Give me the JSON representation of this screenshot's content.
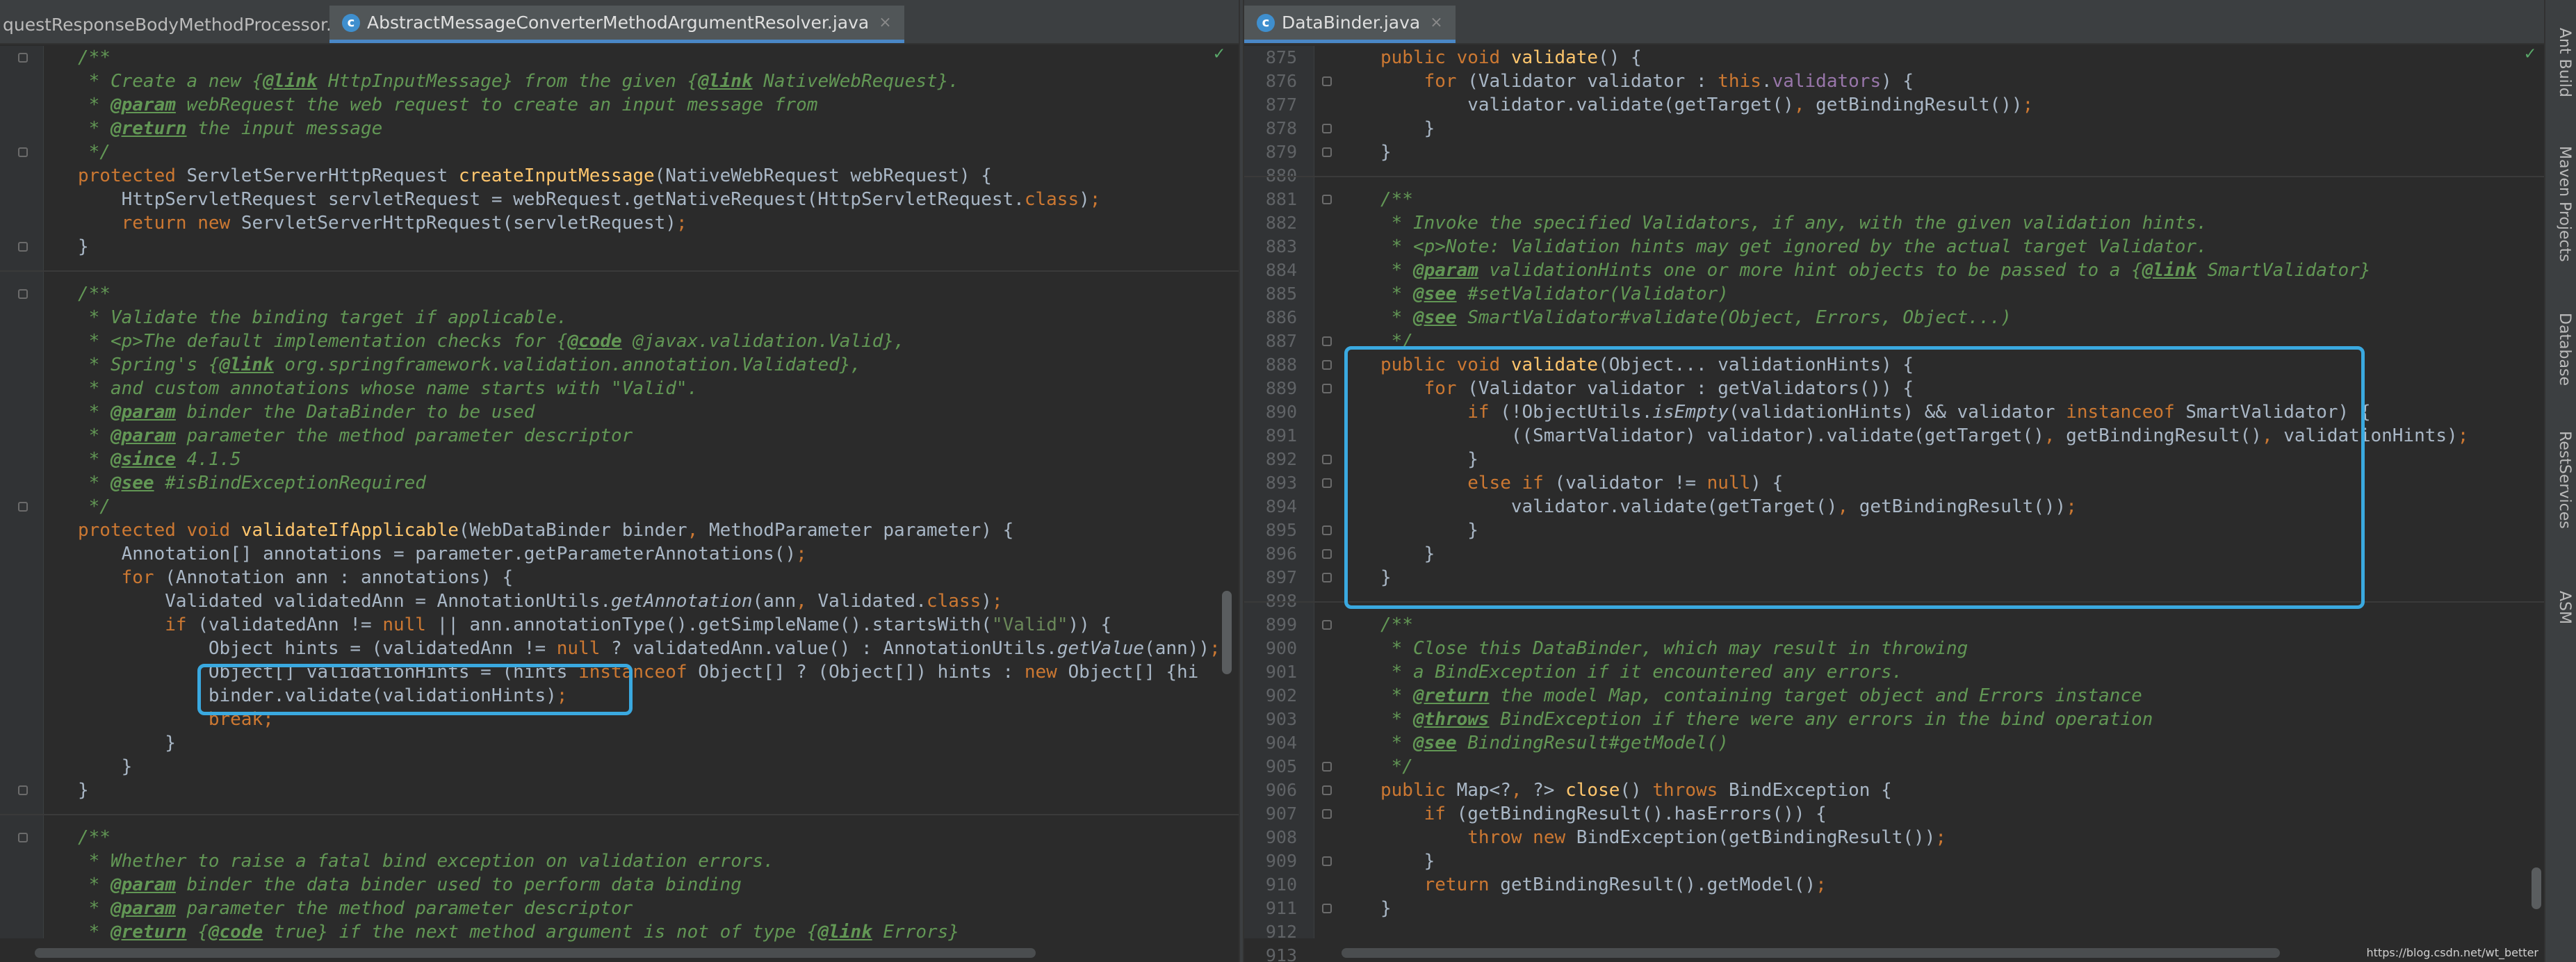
{
  "left_tabs": [
    {
      "label": "questResponseBodyMethodProcessor.java",
      "active": false
    },
    {
      "label": "AbstractMessageConverterMethodArgumentResolver.java",
      "active": true
    }
  ],
  "right_tabs": [
    {
      "label": "DataBinder.java",
      "active": true
    }
  ],
  "icons": {
    "tab_class": "c-icon",
    "close": "close-icon",
    "fold": "fold-icon",
    "check": "check-icon"
  },
  "colors": {
    "keyword": "#cc7832",
    "comment": "#629755",
    "method": "#ffc66d",
    "string": "#6a8759",
    "highlight_box": "#3aa9e0",
    "background": "#2b2b2b"
  },
  "left_code": [
    "/**",
    " * Create a new {@link HttpInputMessage} from the given {@link NativeWebRequest}.",
    " * @param webRequest the web request to create an input message from",
    " * @return the input message",
    " */",
    "protected ServletServerHttpRequest createInputMessage(NativeWebRequest webRequest) {",
    "    HttpServletRequest servletRequest = webRequest.getNativeRequest(HttpServletRequest.class);",
    "    return new ServletServerHttpRequest(servletRequest);",
    "}",
    "",
    "/**",
    " * Validate the binding target if applicable.",
    " * <p>The default implementation checks for {@code @javax.validation.Valid},",
    " * Spring's {@link org.springframework.validation.annotation.Validated},",
    " * and custom annotations whose name starts with \"Valid\".",
    " * @param binder the DataBinder to be used",
    " * @param parameter the method parameter descriptor",
    " * @since 4.1.5",
    " * @see #isBindExceptionRequired",
    " */",
    "protected void validateIfApplicable(WebDataBinder binder, MethodParameter parameter) {",
    "    Annotation[] annotations = parameter.getParameterAnnotations();",
    "    for (Annotation ann : annotations) {",
    "        Validated validatedAnn = AnnotationUtils.getAnnotation(ann, Validated.class);",
    "        if (validatedAnn != null || ann.annotationType().getSimpleName().startsWith(\"Valid\")) {",
    "            Object hints = (validatedAnn != null ? validatedAnn.value() : AnnotationUtils.getValue(ann));",
    "            Object[] validationHints = (hints instanceof Object[] ? (Object[]) hints : new Object[] {hi",
    "            binder.validate(validationHints);",
    "            break;",
    "        }",
    "    }",
    "}",
    "",
    "/**",
    " * Whether to raise a fatal bind exception on validation errors.",
    " * @param binder the data binder used to perform data binding",
    " * @param parameter the method parameter descriptor",
    " * @return {@code true} if the next method argument is not of type {@link Errors}"
  ],
  "right_line_numbers": [
    "875",
    "876",
    "877",
    "878",
    "879",
    "880",
    "881",
    "882",
    "883",
    "884",
    "885",
    "886",
    "887",
    "888",
    "889",
    "890",
    "891",
    "892",
    "893",
    "894",
    "895",
    "896",
    "897",
    "898",
    "899",
    "900",
    "901",
    "902",
    "903",
    "904",
    "905",
    "906",
    "907",
    "908",
    "909",
    "910",
    "911",
    "912",
    "913"
  ],
  "right_code": [
    "public void validate() {",
    "    for (Validator validator : this.validators) {",
    "        validator.validate(getTarget(), getBindingResult());",
    "    }",
    "}",
    "",
    "/**",
    " * Invoke the specified Validators, if any, with the given validation hints.",
    " * <p>Note: Validation hints may get ignored by the actual target Validator.",
    " * @param validationHints one or more hint objects to be passed to a {@link SmartValidator}",
    " * @see #setValidator(Validator)",
    " * @see SmartValidator#validate(Object, Errors, Object...)",
    " */",
    "public void validate(Object... validationHints) {",
    "    for (Validator validator : getValidators()) {",
    "        if (!ObjectUtils.isEmpty(validationHints) && validator instanceof SmartValidator) {",
    "            ((SmartValidator) validator).validate(getTarget(), getBindingResult(), validationHints);",
    "        }",
    "        else if (validator != null) {",
    "            validator.validate(getTarget(), getBindingResult());",
    "        }",
    "    }",
    "}",
    "",
    "/**",
    " * Close this DataBinder, which may result in throwing",
    " * a BindException if it encountered any errors.",
    " * @return the model Map, containing target object and Errors instance",
    " * @throws BindException if there were any errors in the bind operation",
    " * @see BindingResult#getModel()",
    " */",
    "public Map<?, ?> close() throws BindException {",
    "    if (getBindingResult().hasErrors()) {",
    "        throw new BindException(getBindingResult());",
    "    }",
    "    return getBindingResult().getModel();",
    "}",
    "",
    ""
  ],
  "tool_windows": [
    "Ant Build",
    "Maven Projects",
    "Database",
    "RestServices",
    "ASM"
  ],
  "watermark": "https://blog.csdn.net/wt_better"
}
